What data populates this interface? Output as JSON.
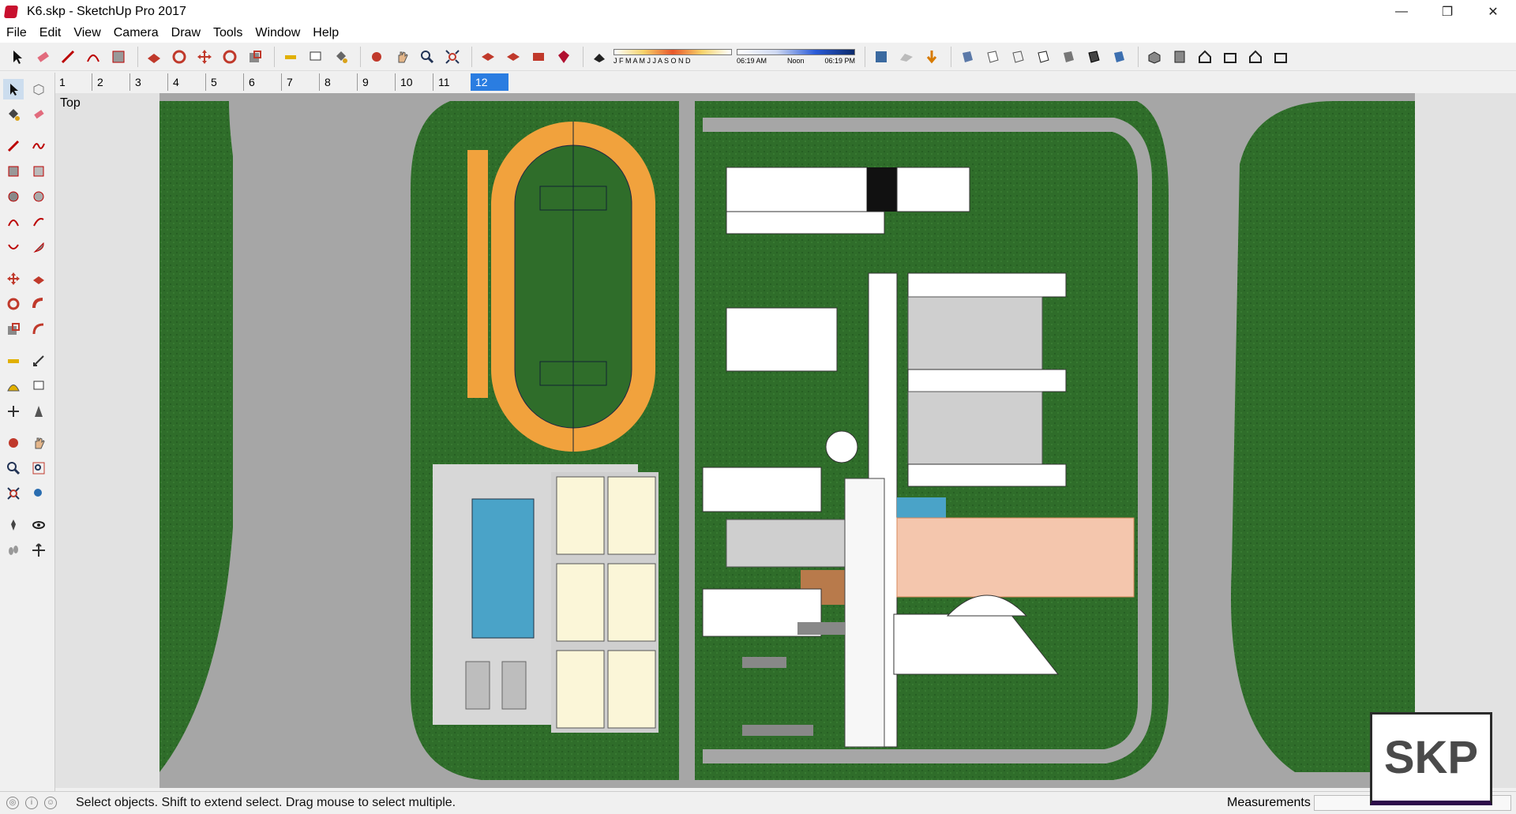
{
  "window": {
    "title": "K6.skp - SketchUp Pro 2017",
    "controls": {
      "minimize": "—",
      "restore": "❐",
      "close": "✕"
    }
  },
  "menu": [
    "File",
    "Edit",
    "View",
    "Camera",
    "Draw",
    "Tools",
    "Window",
    "Help"
  ],
  "shadow": {
    "months": "J F M A M J J A S O N D",
    "time_start": "06:19 AM",
    "time_mid": "Noon",
    "time_end": "06:19 PM"
  },
  "scenes": [
    "1",
    "2",
    "3",
    "4",
    "5",
    "6",
    "7",
    "8",
    "9",
    "10",
    "11",
    "12"
  ],
  "active_scene": "12",
  "viewport": {
    "view_label": "Top"
  },
  "status": {
    "message": "Select objects. Shift to extend select. Drag mouse to select multiple.",
    "measurements_label": "Measurements"
  },
  "badge": {
    "text": "SKP"
  },
  "colors": {
    "grass": "#2f6d2a",
    "road": "#a6a6a6",
    "track": "#f1a23d",
    "pool": "#4aa3c8",
    "court": "#fbf6d8",
    "plaza": "#f4c6ad"
  }
}
